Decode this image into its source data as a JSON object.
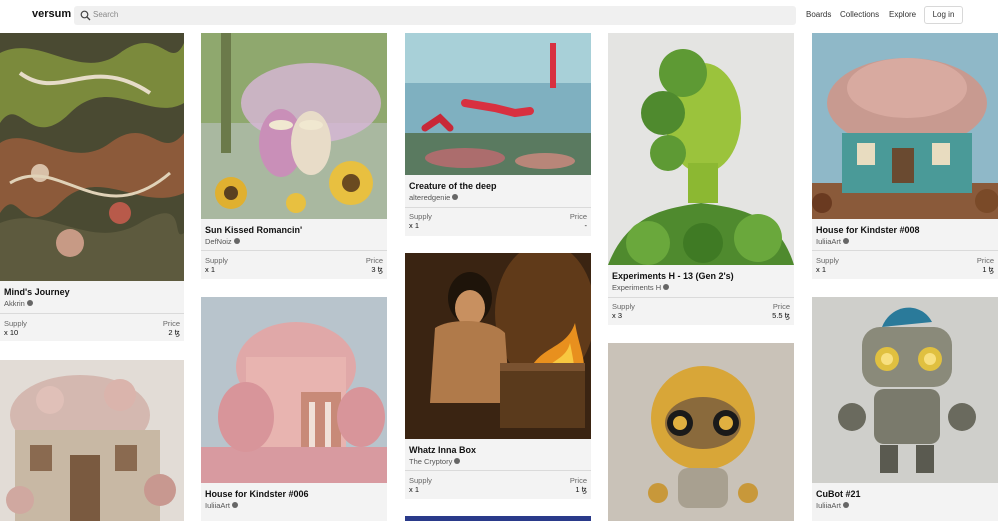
{
  "header": {
    "logo": "versum",
    "search_placeholder": "Search",
    "nav": [
      "Boards",
      "Collections",
      "Explore"
    ],
    "login_label": "Log in"
  },
  "cards": [
    {
      "title": "Mind's Journey",
      "artist": "Akkrin",
      "supply_label": "Supply",
      "supply": "x 10",
      "price_label": "Price",
      "price": "2 ꜩ"
    },
    {
      "title": "Sun Kissed Romancin'",
      "artist": "DefNoiz",
      "supply_label": "Supply",
      "supply": "x 1",
      "price_label": "Price",
      "price": "3 ꜩ"
    },
    {
      "title": "Creature of the deep",
      "artist": "alteredgenie",
      "supply_label": "Supply",
      "supply": "x 1",
      "price_label": "Price",
      "price": "-"
    },
    {
      "title": "Experiments H - 13 (Gen 2's)",
      "artist": "Experiments H",
      "supply_label": "Supply",
      "supply": "x 3",
      "price_label": "Price",
      "price": "5.5 ꜩ"
    },
    {
      "title": "House for Kindster #008",
      "artist": "IuliiaArt",
      "supply_label": "Supply",
      "supply": "x 1",
      "price_label": "Price",
      "price": "1 ꜩ"
    },
    {
      "title": "House for Kindster #006",
      "artist": "IuliiaArt"
    },
    {
      "title": "Whatz Inna Box",
      "artist": "The Cryptory",
      "supply_label": "Supply",
      "supply": "x 1",
      "price_label": "Price",
      "price": "1 ꜩ"
    },
    {
      "title": "CuBot #21",
      "artist": "IuliiaArt"
    }
  ]
}
